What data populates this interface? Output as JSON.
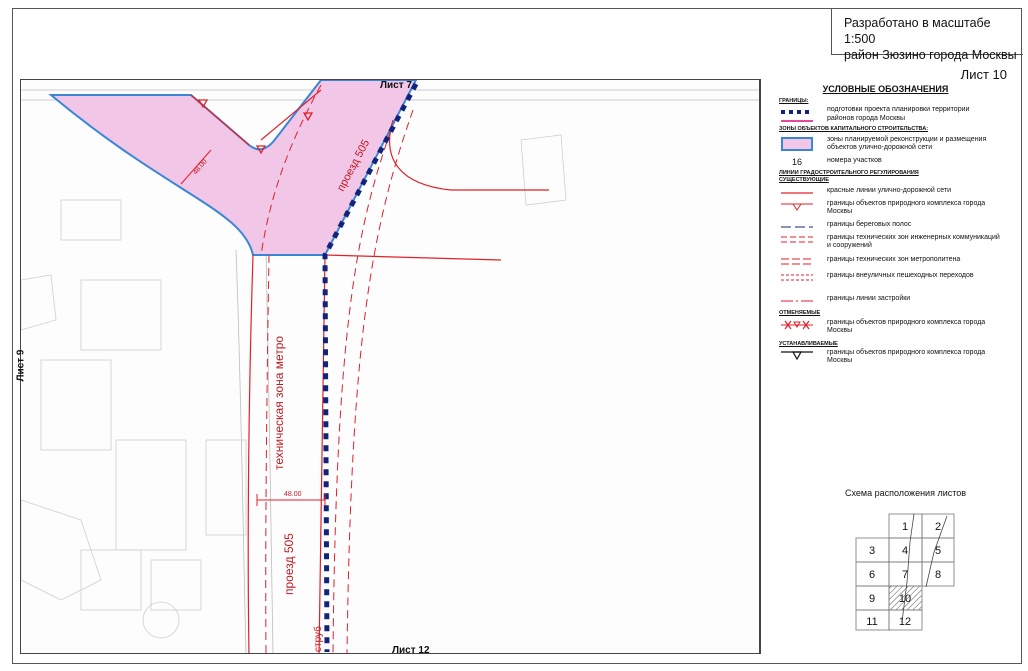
{
  "title_block": {
    "line1": "Разработано в масштабе 1:500",
    "line2": "район Зюзино города Москвы"
  },
  "sheet_label": "Лист 10",
  "map": {
    "edge_top": "Лист 7",
    "edge_bottom": "Лист 12",
    "edge_left": "Лист 9",
    "road_label_upper": "проезд 505",
    "road_label_lower": "проезд 505",
    "metro_zone_label": "техническая зона метро",
    "dimension_label": "48.00",
    "width_label_diag": "48.00",
    "pipe_label": "струб"
  },
  "legend": {
    "title": "УСЛОВНЫЕ ОБОЗНАЧЕНИЯ",
    "groups": {
      "borders": "ГРАНИЦЫ:",
      "capital_zones": "ЗОНЫ ОБЪЕКТОВ КАПИТАЛЬНОГО СТРОИТЕЛЬСТВА:",
      "regulation_lines": "ЛИНИИ ГРАДОСТРОИТЕЛЬНОГО РЕГУЛИРОВАНИЯ",
      "existing": "СУЩЕСТВУЮЩИЕ",
      "cancelled": "ОТМЕНЯЕМЫЕ",
      "established": "УСТАНАВЛИВАЕМЫЕ"
    },
    "items": {
      "project_border": "подготовки проекта планировки территории",
      "district_border": "районов города Москвы",
      "recon_zone": "зоны планируемой реконструкции и размещения объектов улично-дорожной сети",
      "plot_number_symbol": "16",
      "plot_numbers": "номера участков",
      "red_lines": "красные линии улично-дорожной сети",
      "nature_existing": "границы объектов природного комплекса города Москвы",
      "coastal": "границы береговых полос",
      "engineering": "границы технических зон инженерных коммуникаций и сооружений",
      "metro": "границы технических зон метрополитена",
      "crossings": "границы внеуличных пешеходных переходов",
      "building_line": "границы линии застройки",
      "nature_cancelled": "границы объектов природного комплекса города Москвы",
      "nature_established": "границы объектов природного комплекса города Москвы"
    }
  },
  "scheme": {
    "title": "Схема расположения листов",
    "cells": [
      "1",
      "2",
      "3",
      "4",
      "5",
      "6",
      "7",
      "8",
      "9",
      "10",
      "11",
      "12"
    ]
  },
  "colors": {
    "zone_fill": "#f2c6e6",
    "zone_border": "#3a86d6",
    "project_border": "#13237a",
    "red_line": "#e0212a",
    "district": "#e8479a"
  }
}
